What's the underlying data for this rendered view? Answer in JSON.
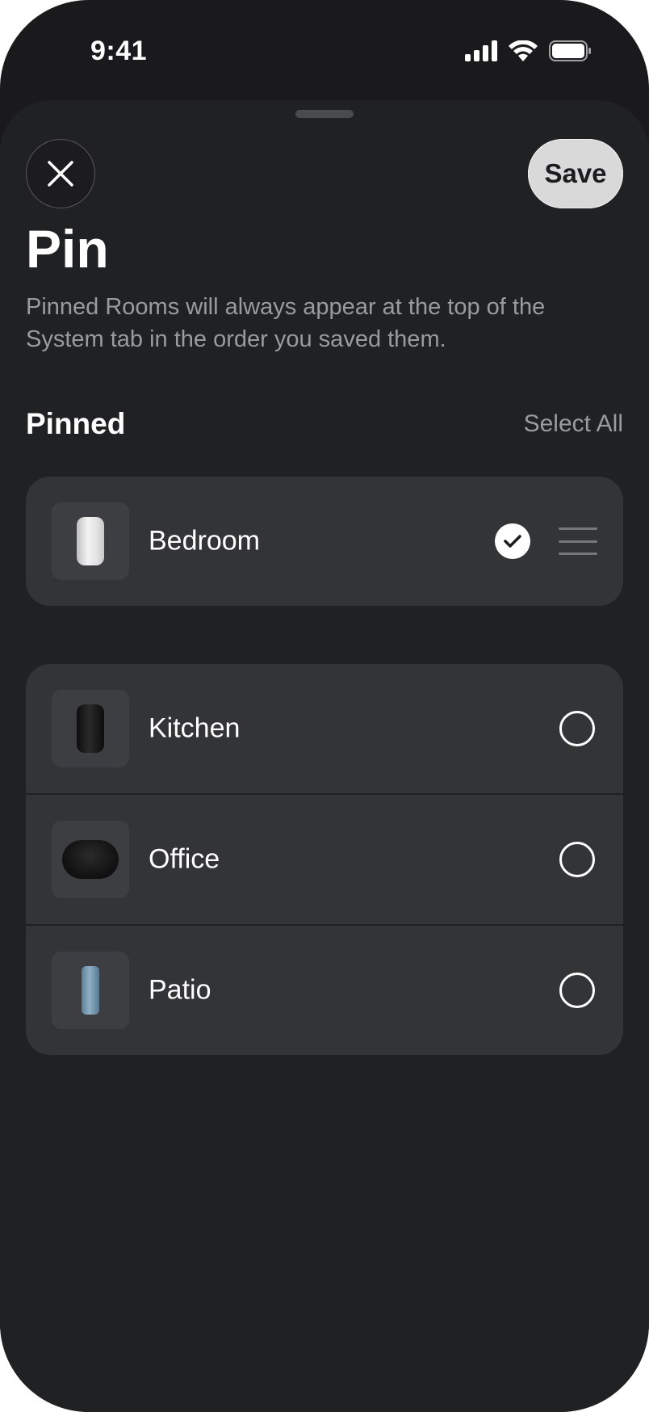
{
  "status_bar": {
    "time": "9:41",
    "icons": [
      "cellular-signal-icon",
      "wifi-icon",
      "battery-icon"
    ]
  },
  "header": {
    "close_icon": "close-icon",
    "save_label": "Save"
  },
  "title": "Pin",
  "subtitle": "Pinned Rooms will always appear at the top of the System tab in the order you saved them.",
  "section": {
    "title": "Pinned",
    "select_all_label": "Select All"
  },
  "pinned_rooms": [
    {
      "name": "Bedroom",
      "selected": true,
      "speaker": "white-speaker-image"
    }
  ],
  "other_rooms": [
    {
      "name": "Kitchen",
      "selected": false,
      "speaker": "black-speaker-image"
    },
    {
      "name": "Office",
      "selected": false,
      "speaker": "black-wide-speaker-image"
    },
    {
      "name": "Patio",
      "selected": false,
      "speaker": "blue-portable-speaker-image"
    }
  ],
  "colors": {
    "background": "#1a1a1c",
    "sheet": "#202123",
    "card": "#333436",
    "text_primary": "#ffffff",
    "text_secondary": "#9a9b9f",
    "save_button": "#d9d9d9"
  }
}
